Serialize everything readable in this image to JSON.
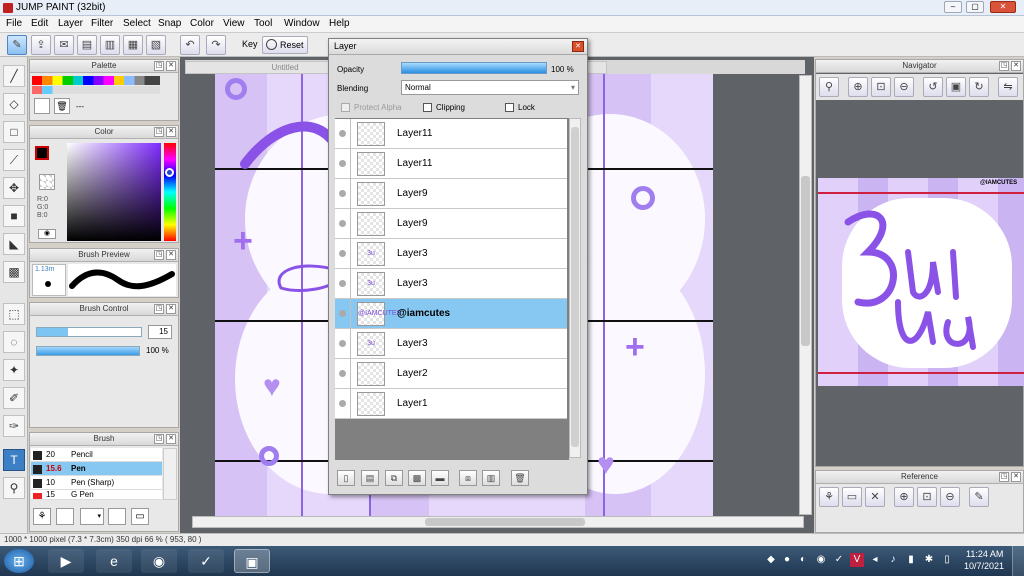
{
  "app": {
    "title": "JUMP PAINT (32bit)",
    "accent": "#3d7fc4"
  },
  "menu": [
    "File",
    "Edit",
    "Layer",
    "Filter",
    "Select",
    "Snap",
    "Color",
    "View",
    "Tool",
    "Window",
    "Help"
  ],
  "toolbar": {
    "key_label": "Key",
    "reset_label": "Reset"
  },
  "tabs": [
    "Untitled",
    "Untitled"
  ],
  "panels": {
    "palette": {
      "title": "Palette",
      "status": "---"
    },
    "color": {
      "title": "Color",
      "r": "R:0",
      "g": "G:0",
      "b": "B:0"
    },
    "brush_preview": {
      "title": "Brush Preview",
      "size": "1.13m"
    },
    "brush_control": {
      "title": "Brush Control",
      "size_value": "15",
      "opacity_value": "100 %"
    },
    "brush": {
      "title": "Brush",
      "items": [
        {
          "size": "20",
          "name": "Pencil"
        },
        {
          "size": "15.6",
          "name": "Pen"
        },
        {
          "size": "10",
          "name": "Pen (Sharp)"
        },
        {
          "size": "15",
          "name": "G Pen"
        }
      ]
    },
    "navigator": {
      "title": "Navigator",
      "watermark": "@IAMCUTES"
    },
    "reference": {
      "title": "Reference"
    }
  },
  "layer_panel": {
    "title": "Layer",
    "opacity_label": "Opacity",
    "opacity_value": "100 %",
    "opacity_fraction": 1.0,
    "blending_label": "Blending",
    "blending_value": "Normal",
    "protect_alpha": "Protect Alpha",
    "clipping": "Clipping",
    "lock": "Lock",
    "layers": [
      {
        "name": "Layer11",
        "thumb": "",
        "selected": false
      },
      {
        "name": "Layer11",
        "thumb": "",
        "selected": false
      },
      {
        "name": "Layer9",
        "thumb": "",
        "selected": false
      },
      {
        "name": "Layer9",
        "thumb": "",
        "selected": false
      },
      {
        "name": "Layer3",
        "thumb": "3u",
        "selected": false
      },
      {
        "name": "Layer3",
        "thumb": "3u",
        "selected": false
      },
      {
        "name": "@iamcutes",
        "thumb": "@IAMCUTES",
        "selected": true
      },
      {
        "name": "Layer3",
        "thumb": "3u",
        "selected": false
      },
      {
        "name": "Layer2",
        "thumb": "",
        "selected": false
      },
      {
        "name": "Layer1",
        "thumb": "",
        "selected": false
      }
    ]
  },
  "status_bar": {
    "text": "1000 * 1000 pixel   (7.3 * 7.3cm)   350 dpi   66 %   ( 953, 80 )"
  },
  "taskbar": {
    "time": "11:24 AM",
    "date": "10/7/2021"
  }
}
